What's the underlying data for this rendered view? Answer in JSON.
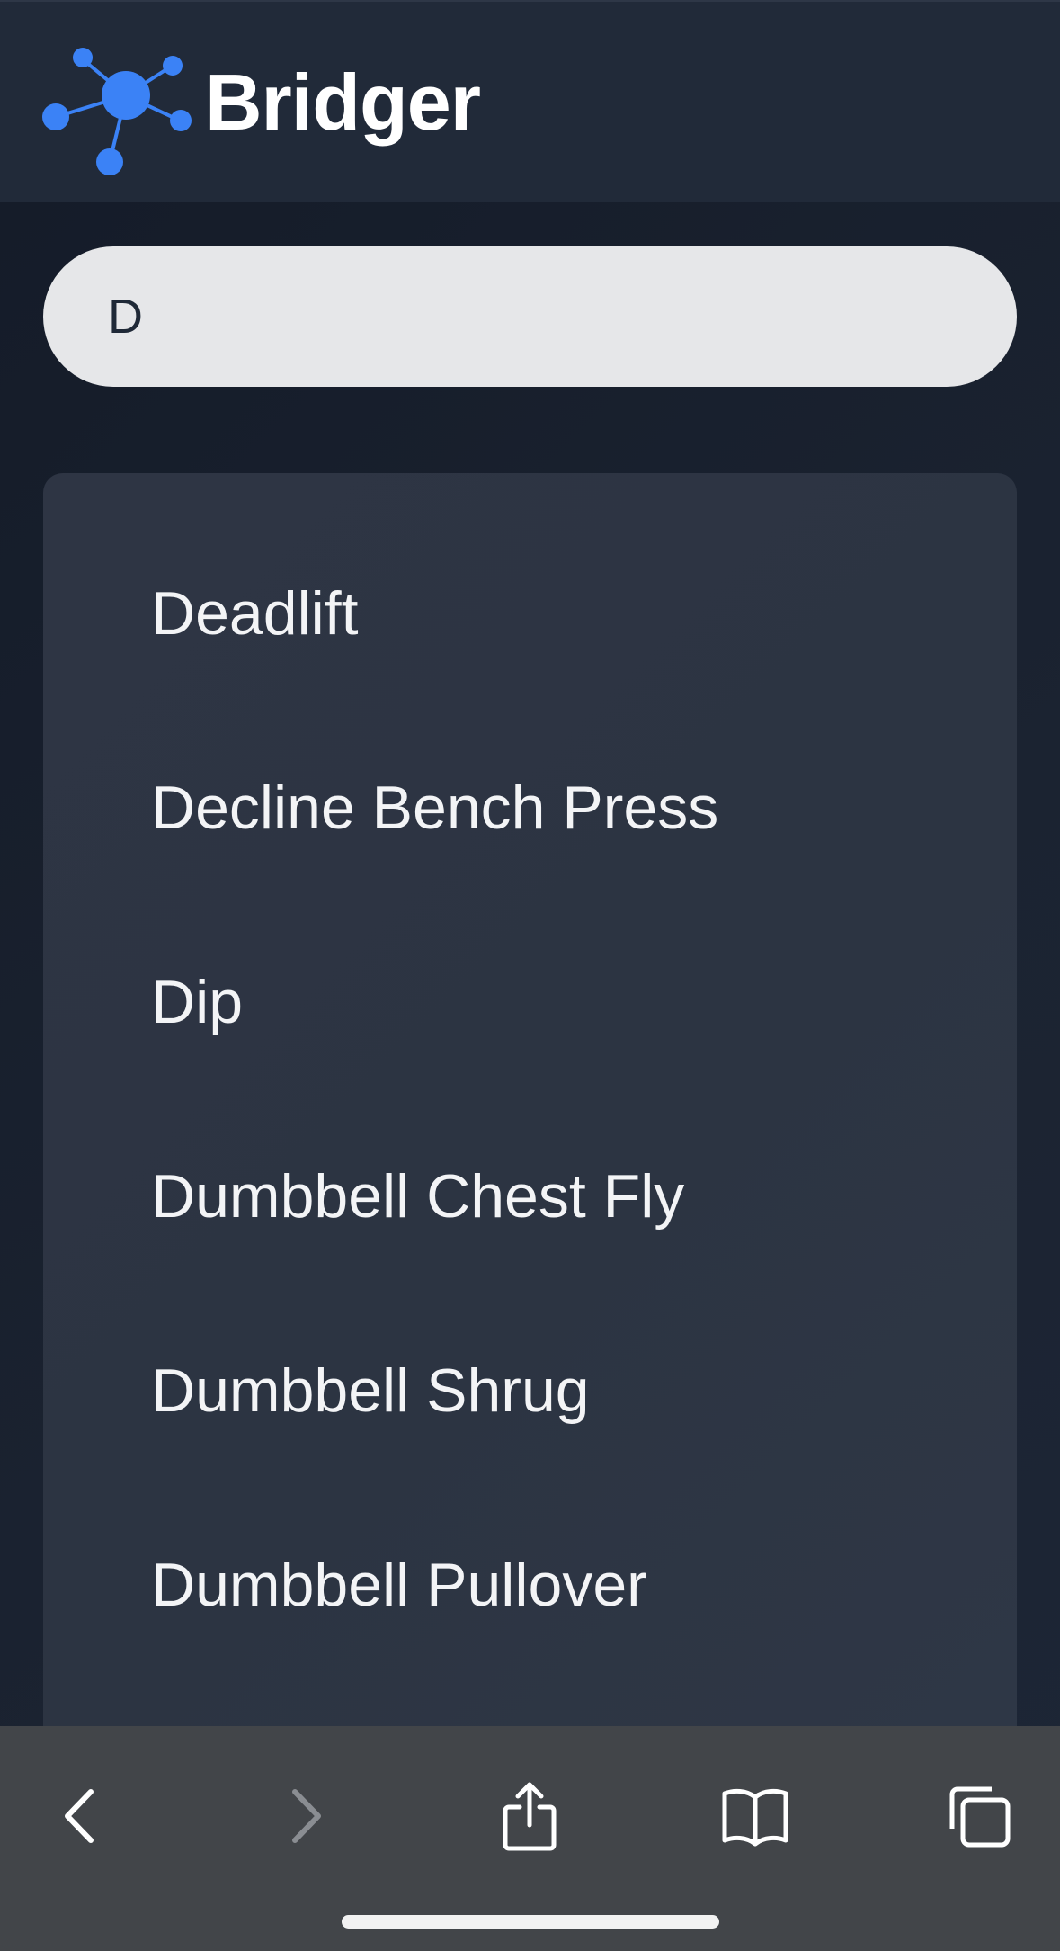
{
  "header": {
    "app_name": "Bridger",
    "logo_icon": "network-nodes-icon"
  },
  "search": {
    "value": "D"
  },
  "results": {
    "items": [
      {
        "label": "Deadlift"
      },
      {
        "label": "Decline Bench Press"
      },
      {
        "label": "Dip"
      },
      {
        "label": "Dumbbell Chest Fly"
      },
      {
        "label": "Dumbbell Shrug"
      },
      {
        "label": "Dumbbell Pullover"
      }
    ]
  },
  "toolbar": {
    "buttons": [
      {
        "icon": "chevron-left-icon",
        "enabled": true
      },
      {
        "icon": "chevron-right-icon",
        "enabled": false
      },
      {
        "icon": "share-icon",
        "enabled": true
      },
      {
        "icon": "bookmarks-icon",
        "enabled": true
      },
      {
        "icon": "tabs-icon",
        "enabled": true
      }
    ]
  },
  "colors": {
    "accent": "#3b82f6",
    "header_bg": "#212a39",
    "page_bg": "#172030",
    "search_bg": "#e6e7e9",
    "results_bg": "#2e3544",
    "toolbar_bg": "#424549"
  }
}
